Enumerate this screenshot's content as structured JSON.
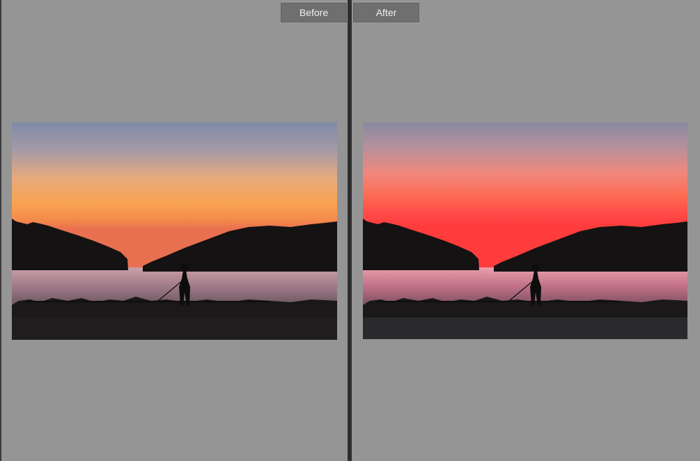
{
  "compare": {
    "before_label": "Before",
    "after_label": "After"
  },
  "colors": {
    "pane_background": "#959595",
    "divider": "#2e2e2e",
    "label_background": "#6f6f6f",
    "before_sky_top": "#7f8aa8",
    "before_sky_horizon": "#f8a050",
    "after_sky_top": "#868aa2",
    "after_sky_horizon": "#ff3c3c"
  }
}
